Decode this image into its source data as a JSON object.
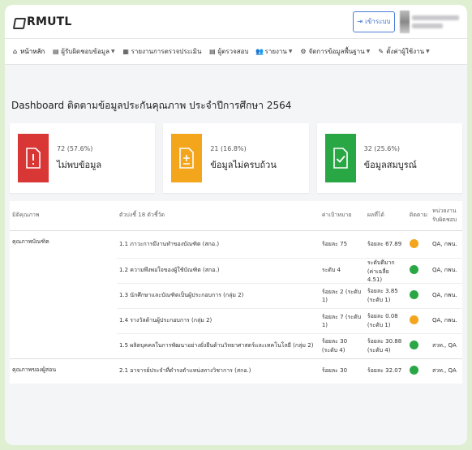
{
  "app": {
    "title": "RMUTL"
  },
  "header": {
    "login_label": "เข้าระบบ",
    "user_name": "",
    "user_role": ""
  },
  "nav": {
    "items": [
      {
        "label": "หน้าหลัก",
        "icon": "home-icon",
        "caret": false
      },
      {
        "label": "ผู้รับผิดชอบข้อมูล",
        "icon": "document-icon",
        "caret": true
      },
      {
        "label": "รายงานการตรวจประเมิน",
        "icon": "report-icon",
        "caret": false
      },
      {
        "label": "ผู้ตรวจสอบ",
        "icon": "document-icon",
        "caret": false
      },
      {
        "label": "รายงาน",
        "icon": "users-icon",
        "caret": true
      },
      {
        "label": "จัดการข้อมูลพื้นฐาน",
        "icon": "settings-icon",
        "caret": true
      },
      {
        "label": "ตั้งค่าผู้ใช้งาน",
        "icon": "user-settings-icon",
        "caret": true
      }
    ]
  },
  "page": {
    "title": "Dashboard ติดตามข้อมูลประกันคุณภาพ ประจำปีการศึกษา 2564"
  },
  "cards": [
    {
      "count": "72 (57.6%)",
      "label": "ไม่พบข้อมูล",
      "color": "#d93636",
      "icon": "alert-document-icon"
    },
    {
      "count": "21 (16.8%)",
      "label": "ข้อมูลไม่ครบถ้วน",
      "color": "#f3a51c",
      "icon": "pending-document-icon"
    },
    {
      "count": "32 (25.6%)",
      "label": "ข้อมูลสมบูรณ์",
      "color": "#29a745",
      "icon": "check-document-icon"
    }
  ],
  "table": {
    "headers": [
      "มิติคุณภาพ",
      "ตัวบ่งชี้ 18 ตัวชี้วัด",
      "ค่าเป้าหมาย",
      "ผลที่ได้",
      "ติดตาม",
      "หน่วยงานรับผิดชอบ"
    ],
    "groups": [
      {
        "name": "คุณภาพบัณฑิต",
        "rows": [
          {
            "indicator": "1.1 ภาวะการมีงานทำของบัณฑิต (สกอ.)",
            "target": "ร้อยละ 75",
            "result": "ร้อยละ 67.89",
            "status": "#f3a51c",
            "owner": "QA, กพน."
          },
          {
            "indicator": "1.2 ความพึงพอใจของผู้ใช้บัณฑิต (สกอ.)",
            "target": "ระดับ 4",
            "result": "ระดับดีมาก (ค่าเฉลี่ย 4.51)",
            "status": "#29a745",
            "owner": "QA, กพน."
          },
          {
            "indicator": "1.3 นักศึกษาและบัณฑิตเป็นผู้ประกอบการ (กลุ่ม 2)",
            "target": "ร้อยละ 2 (ระดับ 1)",
            "result": "ร้อยละ 3.85 (ระดับ 1)",
            "status": "#29a745",
            "owner": "QA, กพน."
          },
          {
            "indicator": "1.4 รางวัลด้านผู้ประกอบการ (กลุ่ม 2)",
            "target": "ร้อยละ 7 (ระดับ 1)",
            "result": "ร้อยละ 0.08 (ระดับ 1)",
            "status": "#f3a51c",
            "owner": "QA, กพน."
          },
          {
            "indicator": "1.5 ผลิตบุคคลในการพัฒนาอย่างยั่งยืนด้านวิทยาศาสตร์และเทคโนโลยี (กลุ่ม 2)",
            "target": "ร้อยละ 30 (ระดับ 4)",
            "result": "ร้อยละ 30.88 (ระดับ 4)",
            "status": "#29a745",
            "owner": "สวท., QA"
          }
        ]
      },
      {
        "name": "คุณภาพของผู้สอน",
        "rows": [
          {
            "indicator": "2.1 อาจารย์ประจำที่ดำรงตำแหน่งทางวิชาการ (สกอ.)",
            "target": "ร้อยละ 30",
            "result": "ร้อยละ 32.07",
            "status": "#29a745",
            "owner": "สวท., QA"
          }
        ]
      }
    ]
  }
}
